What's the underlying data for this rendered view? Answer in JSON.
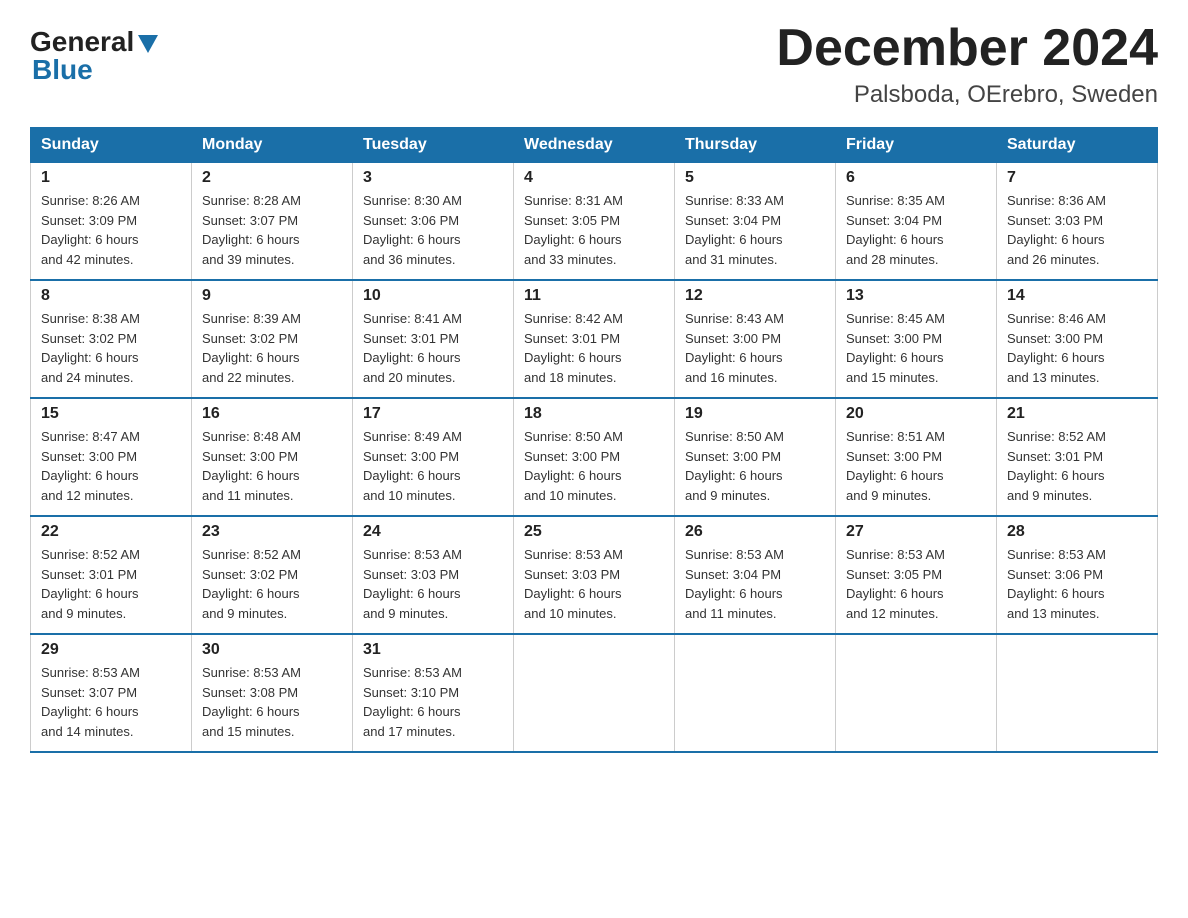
{
  "logo": {
    "general": "General",
    "blue": "Blue"
  },
  "title": "December 2024",
  "subtitle": "Palsboda, OErebro, Sweden",
  "days_of_week": [
    "Sunday",
    "Monday",
    "Tuesday",
    "Wednesday",
    "Thursday",
    "Friday",
    "Saturday"
  ],
  "weeks": [
    [
      {
        "day": "1",
        "sunrise": "8:26 AM",
        "sunset": "3:09 PM",
        "daylight": "6 hours and 42 minutes."
      },
      {
        "day": "2",
        "sunrise": "8:28 AM",
        "sunset": "3:07 PM",
        "daylight": "6 hours and 39 minutes."
      },
      {
        "day": "3",
        "sunrise": "8:30 AM",
        "sunset": "3:06 PM",
        "daylight": "6 hours and 36 minutes."
      },
      {
        "day": "4",
        "sunrise": "8:31 AM",
        "sunset": "3:05 PM",
        "daylight": "6 hours and 33 minutes."
      },
      {
        "day": "5",
        "sunrise": "8:33 AM",
        "sunset": "3:04 PM",
        "daylight": "6 hours and 31 minutes."
      },
      {
        "day": "6",
        "sunrise": "8:35 AM",
        "sunset": "3:04 PM",
        "daylight": "6 hours and 28 minutes."
      },
      {
        "day": "7",
        "sunrise": "8:36 AM",
        "sunset": "3:03 PM",
        "daylight": "6 hours and 26 minutes."
      }
    ],
    [
      {
        "day": "8",
        "sunrise": "8:38 AM",
        "sunset": "3:02 PM",
        "daylight": "6 hours and 24 minutes."
      },
      {
        "day": "9",
        "sunrise": "8:39 AM",
        "sunset": "3:02 PM",
        "daylight": "6 hours and 22 minutes."
      },
      {
        "day": "10",
        "sunrise": "8:41 AM",
        "sunset": "3:01 PM",
        "daylight": "6 hours and 20 minutes."
      },
      {
        "day": "11",
        "sunrise": "8:42 AM",
        "sunset": "3:01 PM",
        "daylight": "6 hours and 18 minutes."
      },
      {
        "day": "12",
        "sunrise": "8:43 AM",
        "sunset": "3:00 PM",
        "daylight": "6 hours and 16 minutes."
      },
      {
        "day": "13",
        "sunrise": "8:45 AM",
        "sunset": "3:00 PM",
        "daylight": "6 hours and 15 minutes."
      },
      {
        "day": "14",
        "sunrise": "8:46 AM",
        "sunset": "3:00 PM",
        "daylight": "6 hours and 13 minutes."
      }
    ],
    [
      {
        "day": "15",
        "sunrise": "8:47 AM",
        "sunset": "3:00 PM",
        "daylight": "6 hours and 12 minutes."
      },
      {
        "day": "16",
        "sunrise": "8:48 AM",
        "sunset": "3:00 PM",
        "daylight": "6 hours and 11 minutes."
      },
      {
        "day": "17",
        "sunrise": "8:49 AM",
        "sunset": "3:00 PM",
        "daylight": "6 hours and 10 minutes."
      },
      {
        "day": "18",
        "sunrise": "8:50 AM",
        "sunset": "3:00 PM",
        "daylight": "6 hours and 10 minutes."
      },
      {
        "day": "19",
        "sunrise": "8:50 AM",
        "sunset": "3:00 PM",
        "daylight": "6 hours and 9 minutes."
      },
      {
        "day": "20",
        "sunrise": "8:51 AM",
        "sunset": "3:00 PM",
        "daylight": "6 hours and 9 minutes."
      },
      {
        "day": "21",
        "sunrise": "8:52 AM",
        "sunset": "3:01 PM",
        "daylight": "6 hours and 9 minutes."
      }
    ],
    [
      {
        "day": "22",
        "sunrise": "8:52 AM",
        "sunset": "3:01 PM",
        "daylight": "6 hours and 9 minutes."
      },
      {
        "day": "23",
        "sunrise": "8:52 AM",
        "sunset": "3:02 PM",
        "daylight": "6 hours and 9 minutes."
      },
      {
        "day": "24",
        "sunrise": "8:53 AM",
        "sunset": "3:03 PM",
        "daylight": "6 hours and 9 minutes."
      },
      {
        "day": "25",
        "sunrise": "8:53 AM",
        "sunset": "3:03 PM",
        "daylight": "6 hours and 10 minutes."
      },
      {
        "day": "26",
        "sunrise": "8:53 AM",
        "sunset": "3:04 PM",
        "daylight": "6 hours and 11 minutes."
      },
      {
        "day": "27",
        "sunrise": "8:53 AM",
        "sunset": "3:05 PM",
        "daylight": "6 hours and 12 minutes."
      },
      {
        "day": "28",
        "sunrise": "8:53 AM",
        "sunset": "3:06 PM",
        "daylight": "6 hours and 13 minutes."
      }
    ],
    [
      {
        "day": "29",
        "sunrise": "8:53 AM",
        "sunset": "3:07 PM",
        "daylight": "6 hours and 14 minutes."
      },
      {
        "day": "30",
        "sunrise": "8:53 AM",
        "sunset": "3:08 PM",
        "daylight": "6 hours and 15 minutes."
      },
      {
        "day": "31",
        "sunrise": "8:53 AM",
        "sunset": "3:10 PM",
        "daylight": "6 hours and 17 minutes."
      },
      null,
      null,
      null,
      null
    ]
  ],
  "labels": {
    "sunrise": "Sunrise:",
    "sunset": "Sunset:",
    "daylight": "Daylight:"
  }
}
